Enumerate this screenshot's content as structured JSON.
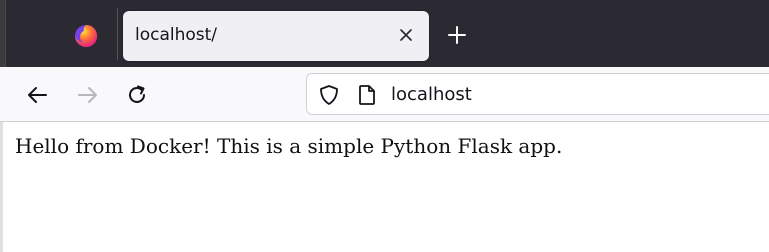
{
  "browser": {
    "tab": {
      "title": "localhost/"
    },
    "urlbar": {
      "address": "localhost"
    },
    "icons": {
      "app": "firefox-icon",
      "tab_close": "close-icon",
      "new_tab": "plus-icon",
      "back": "arrow-left-icon",
      "forward": "arrow-right-icon",
      "reload": "reload-icon",
      "site_security": "shield-icon",
      "page_info": "page-icon"
    },
    "colors": {
      "tabstrip": "#2b2a33",
      "active_tab": "#f0f0f4",
      "toolbar": "#f9f9fb",
      "firefox_orange": "#ff7139",
      "firefox_purple": "#7542e5"
    }
  },
  "page": {
    "body_text": "Hello from Docker! This is a simple Python Flask app."
  }
}
